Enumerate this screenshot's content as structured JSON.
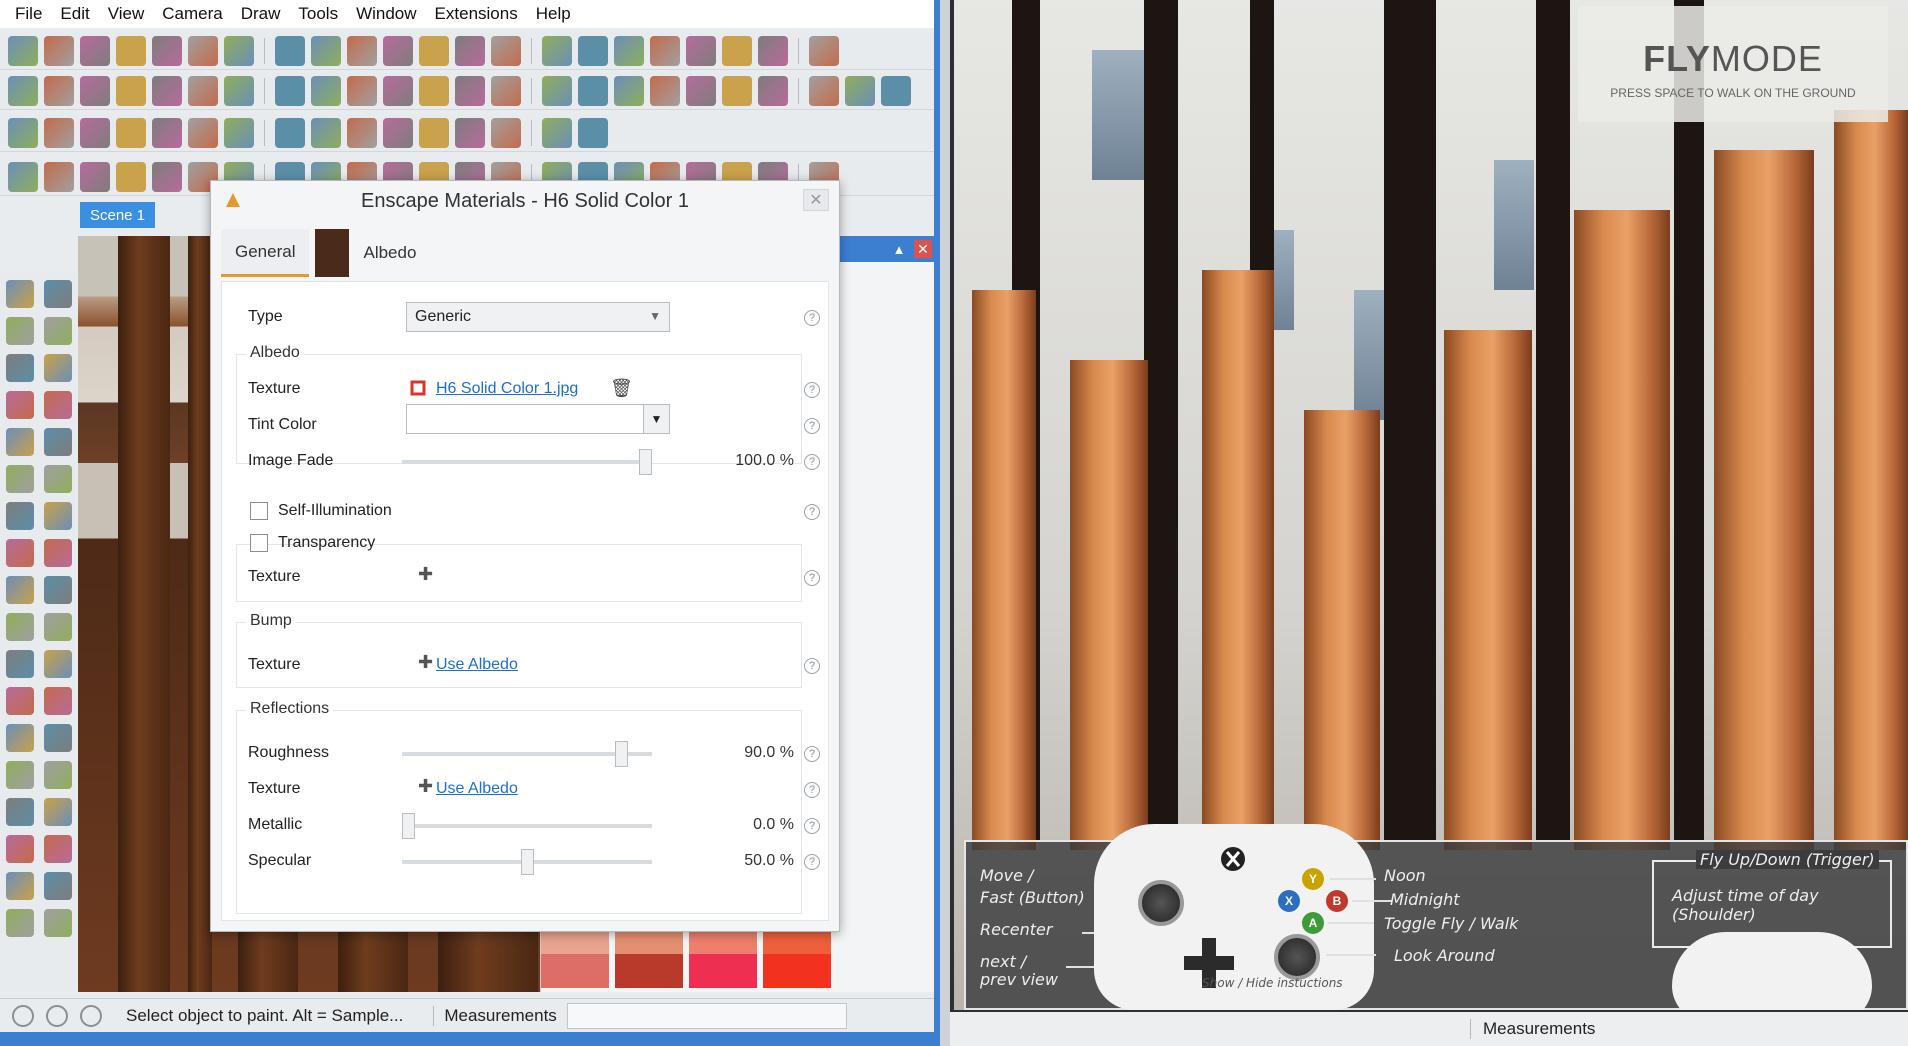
{
  "menubar": {
    "items": [
      "File",
      "Edit",
      "View",
      "Camera",
      "Draw",
      "Tools",
      "Window",
      "Extensions",
      "Help"
    ]
  },
  "scene_tab": "Scene 1",
  "dialog": {
    "title": "Enscape Materials - H6 Solid Color 1",
    "tabs": {
      "general": "General",
      "albedo": "Albedo"
    },
    "type": {
      "label": "Type",
      "value": "Generic"
    },
    "albedo": {
      "group": "Albedo",
      "texture_label": "Texture",
      "texture_file": "H6 Solid Color 1.jpg",
      "tint_label": "Tint Color",
      "fade_label": "Image Fade",
      "fade_value": "100.0 %",
      "fade_fraction": 1.0
    },
    "self_illumination": "Self-Illumination",
    "transparency": {
      "group": "Transparency",
      "texture_label": "Texture"
    },
    "bump": {
      "group": "Bump",
      "texture_label": "Texture",
      "link": "Use Albedo"
    },
    "reflections": {
      "group": "Reflections",
      "roughness_label": "Roughness",
      "roughness_value": "90.0 %",
      "roughness_fraction": 0.9,
      "texture_label": "Texture",
      "texture_link": "Use Albedo",
      "metallic_label": "Metallic",
      "metallic_value": "0.0 %",
      "metallic_fraction": 0.0,
      "specular_label": "Specular",
      "specular_value": "50.0 %",
      "specular_fraction": 0.5
    }
  },
  "statusbar": {
    "text": "Select object to paint. Alt = Sample...",
    "measurements": "Measurements"
  },
  "render": {
    "fly_title_a": "FLY",
    "fly_title_b": "MODE",
    "fly_subtitle": "PRESS SPACE TO WALK ON THE GROUND",
    "controls": {
      "move": "Move /",
      "fast": "Fast (Button)",
      "recenter": "Recenter",
      "next": "next /",
      "prev": "prev view",
      "show_hide": "Show / Hide instuctions",
      "noon": "Noon",
      "midnight": "Midnight",
      "toggle": "Toggle Fly / Walk",
      "look": "Look Around",
      "fly_updown": "Fly Up/Down (Trigger)",
      "time_of_day": "Adjust time of day (Shoulder)",
      "btn_y": "Y",
      "btn_x": "X",
      "btn_b": "B",
      "btn_a": "A"
    },
    "measurements": "Measurements"
  },
  "colors": {
    "accent": "#e59a2c",
    "link": "#1a6fd1",
    "window_border": "#3c7fd0",
    "btn_y": "#c9a400",
    "btn_x": "#2a6fc0",
    "btn_b": "#c0392b",
    "btn_a": "#3f9a3a"
  }
}
